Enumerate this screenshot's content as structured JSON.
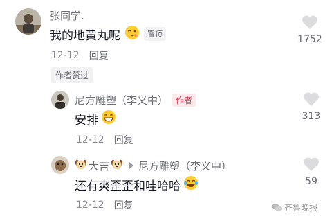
{
  "comments": [
    {
      "user": "张同学.",
      "text": "我的地黄丸呢",
      "emoji": "wink-kiss-emoji",
      "pinned_label": "置顶",
      "date": "12-12",
      "reply_label": "回复",
      "liked_by_author": "作者赞过",
      "likes": "1752"
    },
    {
      "user": "尼方雕塑（李义中）",
      "author_badge": "作者",
      "text": "安排",
      "emoji": "grin-emoji",
      "date": "12-12",
      "reply_label": "回复",
      "likes": "313"
    },
    {
      "user_prefix_emoji": "dog-emoji",
      "user": "大吉",
      "user_suffix_emoji": "dog-emoji",
      "reply_to": "尼方雕塑（李义中）",
      "text": "还有爽歪歪和哇哈哈",
      "emoji": "tears-of-joy-emoji",
      "date": "12-12",
      "reply_label": "回复",
      "likes": "59"
    }
  ],
  "watermark": {
    "icon": "wechat-icon",
    "text": "齐鲁晚报"
  },
  "colors": {
    "accent": "#fe2c55",
    "text": "#161823",
    "meta": "#8a8b91"
  }
}
